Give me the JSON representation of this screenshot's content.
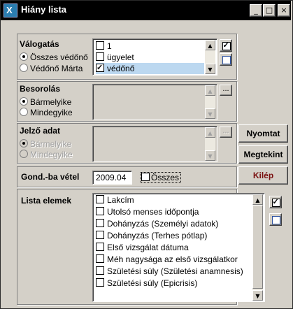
{
  "window": {
    "title": "Hiány lista",
    "app_icon_glyph": "X"
  },
  "title_buttons": {
    "minimize": "_",
    "maximize": "□",
    "close": "×"
  },
  "valogatas": {
    "label": "Válogatás",
    "radios": [
      {
        "label": "Összes védőnő",
        "checked": true
      },
      {
        "label": "Védőnő Márta",
        "checked": false
      }
    ],
    "items": [
      {
        "label": "1",
        "checked": false
      },
      {
        "label": "ügyelet",
        "checked": false
      },
      {
        "label": "védőnő",
        "checked": true,
        "selected": true
      }
    ]
  },
  "besorolas": {
    "label": "Besorolás",
    "radios": [
      {
        "label": "Bármelyike",
        "checked": true
      },
      {
        "label": "Mindegyike",
        "checked": false
      }
    ],
    "browse_label": "..."
  },
  "jelzo_adat": {
    "label": "Jelző adat",
    "radios": [
      {
        "label": "Bármelyike",
        "checked": true
      },
      {
        "label": "Mindegyike",
        "checked": false
      }
    ],
    "browse_label": "..."
  },
  "gond": {
    "label": "Gond.-ba vétel",
    "value": "2009.04",
    "checkbox_label": "Összes",
    "checkbox_checked": false
  },
  "buttons": {
    "print": "Nyomtat",
    "view": "Megtekint",
    "exit": "Kilép"
  },
  "lista": {
    "label": "Lista elemek",
    "items": [
      "Lakcím",
      "Utolsó menses időpontja",
      "Dohányzás (Személyi adatok)",
      "Dohányzás (Terhes pótlap)",
      "Első vizsgálat dátuma",
      "Méh nagysága az első vizsgálatkor",
      "Születési súly (Születési anamnesis)",
      "Születési súly (Epicrisis)"
    ]
  },
  "colors": {
    "exit_text": "#7a1010",
    "selection": "#bcd8f0"
  }
}
